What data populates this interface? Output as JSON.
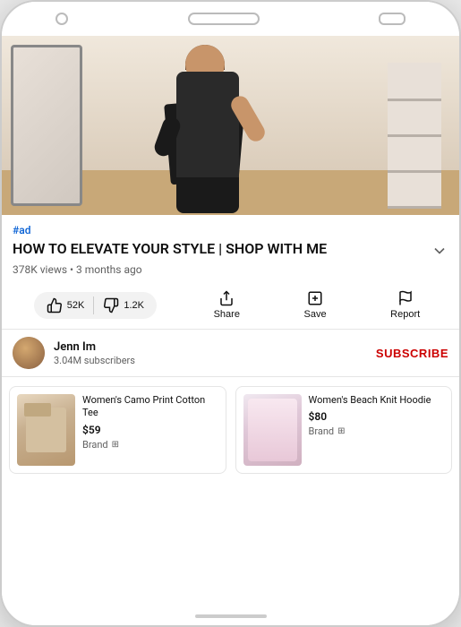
{
  "phone": {
    "top_bar": {
      "circle": "home-button",
      "pill": "speaker",
      "rect": "camera"
    }
  },
  "video": {
    "ad_label": "#ad",
    "title": "HOW TO ELEVATE YOUR STYLE | SHOP WITH ME",
    "views": "378K views",
    "time_ago": "3 months ago",
    "meta": "378K views • 3 months ago"
  },
  "actions": {
    "like_count": "52K",
    "dislike_count": "1.2K",
    "share_label": "Share",
    "save_label": "Save",
    "report_label": "Report"
  },
  "channel": {
    "name": "Jenn Im",
    "subscribers": "3.04M subscribers",
    "subscribe_label": "SUBSCRIBE"
  },
  "products": [
    {
      "name": "Women's Camo Print Cotton Tee",
      "price": "$59",
      "brand": "Brand",
      "link_icon": "↗"
    },
    {
      "name": "Women's Beach Knit Hoodie",
      "price": "$80",
      "brand": "Brand",
      "link_icon": "↗"
    }
  ]
}
